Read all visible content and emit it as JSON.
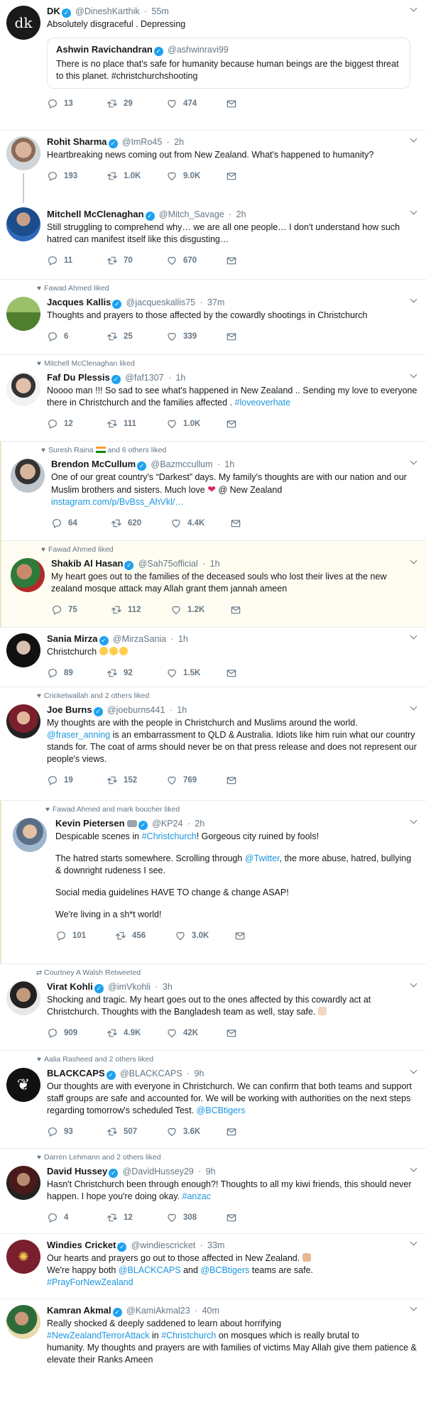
{
  "tweets": [
    {
      "name": "DK",
      "handle": "@DineshKarthik",
      "time": "55m",
      "text": "Absolutely disgraceful . Depressing",
      "quote": {
        "name": "Ashwin Ravichandran",
        "handle": "@ashwinravi99",
        "text": "There is no place that's safe for humanity because human beings are the biggest threat to this planet. #christchurchshooting"
      },
      "replies": "13",
      "retweets": "29",
      "likes": "474"
    },
    {
      "name": "Rohit Sharma",
      "handle": "@ImRo45",
      "time": "2h",
      "text": "Heartbreaking news coming out from New Zealand. What's happened to humanity?",
      "replies": "193",
      "retweets": "1.0K",
      "likes": "9.0K"
    },
    {
      "name": "Mitchell McClenaghan",
      "handle": "@Mitch_Savage",
      "time": "2h",
      "text": "Still struggling to comprehend why… we are all one people… I don't understand how such hatred can manifest itself like this disgusting…",
      "replies": "11",
      "retweets": "70",
      "likes": "670"
    },
    {
      "context": "Fawad Ahmed liked",
      "name": "Jacques Kallis",
      "handle": "@jacqueskallis75",
      "time": "37m",
      "text": "Thoughts and prayers to those affected by the cowardly shootings in Christchurch",
      "replies": "6",
      "retweets": "25",
      "likes": "339"
    },
    {
      "context": "Mitchell McClenaghan liked",
      "name": "Faf Du Plessis",
      "handle": "@faf1307",
      "time": "1h",
      "text": "Noooo man !!! So sad to see what's happened in New Zealand .. Sending my love to everyone there in Christchurch and the families affected .",
      "text_link": "#loveoverhate",
      "replies": "12",
      "retweets": "111",
      "likes": "1.0K"
    },
    {
      "context": "Suresh Raina",
      "context_suffix": "and 6 others liked",
      "name": "Brendon McCullum",
      "handle": "@Bazmccullum",
      "time": "1h",
      "text": "One of our great country's “Darkest” days. My family's thoughts are with our nation and our Muslim brothers and sisters. Much love",
      "text_after": "@ New Zealand",
      "text_link": "instagram.com/p/BvBss_AhVkl/…",
      "replies": "64",
      "retweets": "620",
      "likes": "4.4K"
    },
    {
      "context": "Fawad Ahmed liked",
      "name": "Shakib Al Hasan",
      "handle": "@Sah75official",
      "time": "1h",
      "text": "My heart goes out to the families of the deceased souls who lost their lives at the new zealand mosque attack may Allah grant them jannah ameen",
      "replies": "75",
      "retweets": "112",
      "likes": "1.2K"
    },
    {
      "name": "Sania Mirza",
      "handle": "@MirzaSania",
      "time": "1h",
      "text": "Christchurch",
      "replies": "89",
      "retweets": "92",
      "likes": "1.5K"
    },
    {
      "context": "Cricketwallah and 2 others liked",
      "name": "Joe Burns",
      "handle": "@joeburns441",
      "time": "1h",
      "text": "My thoughts are with the people in Christchurch and Muslims around the world.",
      "text_link": "@fraser_anning",
      "text_after": "is an embarrassment to QLD & Australia. Idiots like him ruin what our country stands for. The coat of arms should never be on that press release and does not represent our people's views.",
      "replies": "19",
      "retweets": "152",
      "likes": "769"
    },
    {
      "context": "Fawad Ahmed and mark boucher liked",
      "name": "Kevin Pietersen",
      "handle": "@KP24",
      "time": "2h",
      "p1a": "Despicable scenes in",
      "p1link": "#Christchurch",
      "p1b": "! Gorgeous city ruined by fools!",
      "p2a": "The hatred starts somewhere. Scrolling through",
      "p2link": "@Twitter",
      "p2b": ", the more abuse, hatred, bullying & downright rudeness I see.",
      "p3": "Social media guidelines HAVE TO change & change ASAP!",
      "p4": "We're living in a sh*t world!",
      "replies": "101",
      "retweets": "456",
      "likes": "3.0K"
    },
    {
      "context": "Courtney A Walsh Retweeted",
      "name": "Virat Kohli",
      "handle": "@imVkohli",
      "time": "3h",
      "text": "Shocking and tragic. My heart goes out to the ones affected by this cowardly act at Christchurch. Thoughts with the Bangladesh team as well, stay safe.",
      "replies": "909",
      "retweets": "4.9K",
      "likes": "42K"
    },
    {
      "context": "Aalia Rasheed and 2 others liked",
      "name": "BLACKCAPS",
      "handle": "@BLACKCAPS",
      "time": "9h",
      "text": "Our thoughts are with everyone in Christchurch. We can confirm that both teams and support staff groups are safe and accounted for. We will be working with authorities on the next steps regarding tomorrow's scheduled Test.",
      "text_link": "@BCBtigers",
      "replies": "93",
      "retweets": "507",
      "likes": "3.6K"
    },
    {
      "context": "Darren Lehmann and 2 others liked",
      "name": "David Hussey",
      "handle": "@DavidHussey29",
      "time": "9h",
      "text": "Hasn't Christchurch been through enough?! Thoughts to all my kiwi friends, this should never happen. I hope you're doing okay.",
      "text_link": "#anzac",
      "replies": "4",
      "retweets": "12",
      "likes": "308"
    },
    {
      "name": "Windies Cricket",
      "handle": "@windiescricket",
      "time": "33m",
      "line1": "Our hearts and prayers go out to those affected in New Zealand.",
      "line2a": "We're happy both",
      "line2link1": "@BLACKCAPS",
      "line2b": "and",
      "line2link2": "@BCBtigers",
      "line2c": "teams are safe.",
      "line3link": "#PrayForNewZealand"
    },
    {
      "name": "Kamran Akmal",
      "handle": "@KamiAkmal23",
      "time": "40m",
      "l1": "Really shocked & deeply saddened to learn about horrifying",
      "l2link1": "#NewZealandTerrorAttack",
      "l2a": "in",
      "l2link2": "#Christchurch",
      "l2b": "on mosques which is really brutal to",
      "l3": "humanity. My thoughts and prayers are with families of victims May Allah give them patience & elevate their Ranks Ameen"
    }
  ],
  "colors": {
    "accent": "#1da1f2",
    "link": "#1b95e0",
    "muted": "#657786"
  }
}
